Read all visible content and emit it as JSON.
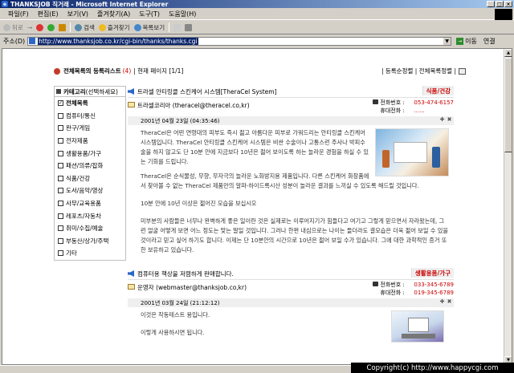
{
  "window": {
    "title": "THANKSJOB 직거래 - Microsoft Internet Explorer"
  },
  "menu": [
    "파일(F)",
    "편집(E)",
    "보기(V)",
    "즐겨찾기(A)",
    "도구(T)",
    "도움말(H)"
  ],
  "toolbar": {
    "back": "뒤로",
    "search": "검색",
    "favorites": "즐겨찾기",
    "history": "목록보기"
  },
  "address": {
    "label": "주소(D)",
    "url": "http://www.thanksjob.co.kr/cgi-bin/thanks/thanks.cgi",
    "go": "이동",
    "links": "연결"
  },
  "page": {
    "list_title": "전체목록의 등록리스트",
    "count": "(4)",
    "current_page": "| 현재 페이지 [1/1]",
    "top_links": "| 등록순정렬 | 전체목록정렬 |"
  },
  "sidebar": {
    "header_bold": "카테고리",
    "header_sub": "(선택하세요)",
    "items": [
      {
        "label": "전체목록",
        "checked": true
      },
      {
        "label": "컴퓨터/통신",
        "checked": false
      },
      {
        "label": "완구/게임",
        "checked": false
      },
      {
        "label": "전자제품",
        "checked": false
      },
      {
        "label": "생활용품/가구",
        "checked": false
      },
      {
        "label": "패션/의류/잡화",
        "checked": false
      },
      {
        "label": "식품/건강",
        "checked": false
      },
      {
        "label": "도서/음악/영상",
        "checked": false
      },
      {
        "label": "사무/교육용품",
        "checked": false
      },
      {
        "label": "레포츠/자동차",
        "checked": false
      },
      {
        "label": "취미/수집/예술",
        "checked": false
      },
      {
        "label": "부동산/상가/주택",
        "checked": false
      },
      {
        "label": "기타",
        "checked": false
      }
    ]
  },
  "entries": [
    {
      "title": "트라셀 안티링클 스킨케어 시스템[TheraCel System]",
      "category": "식품/건강",
      "seller": "트라셀코리아 (theracel@theracel.co,kr)",
      "phone_label": "전화번호 :",
      "phone": "053-474-6157",
      "mobile_label": "휴대전화 :",
      "mobile": "......",
      "date": "2001년 04월 23일 (04:35:46)",
      "body": [
        "TheraCel은 어떤 연령대의 피부도 즉시 젊고 아름다운 피부로 가꿔드리는 안티링클 스킨케어 시스템입니다. TheraCel 안티링클 스킨케어 시스템은 비싼 수술이나 고통스런 주사나 박피수술을 하지 않고도 단 10분 안에 지금보다 10년은 젊어 보이도록 하는 놀라운 경험을 하실 수 있는 기회를 드립니다.",
        "TheraCel은 순식물성, 무향, 무자극의 놀라운 노화방지용 제품입니다. 다른 스킨케어 화장품에서 찾아볼 수 없는 TheraCel 제품만의 알파-하이드록시산 성분이 놀라운 결과를 느끼실 수 있도록 해드릴 것입니다.",
        "10분 안에 10년 이상은 젊어진 모습을 보십시오",
        "미부분의 사람들은 너무나 완벽하게 좋은 일이란 것은 실제로는 이루어지기가 힘들다고 여기고 그렇게 믿으면서 자라왔는데, 그런 얼굴 어떻게 보면 어느 정도는 맞는 말일 것입니다. 그러나 한편 내심으로는 나이는 들더라도 결모습은 더욱 젊어 보일 수 있을 것이라고 믿고 싶어 하기도 합니다. 이제는 단 10분안의 시간으로 10년은 젊어 보일 수가 있습니다. 그에 대한 과학적인 증거 또한 보유하고 있습니다."
      ]
    },
    {
      "title": "컴퓨터용 책상을 저렴하게 판매합니다.",
      "category": "생활용품/가구",
      "seller": "운영자 (webmaster@thanksjob.co,kr)",
      "phone_label": "전화번호 :",
      "phone": "033-345-6789",
      "mobile_label": "휴대전화 :",
      "mobile": "019-345-6789",
      "date": "2001년 03월 24일 (21:12:12)",
      "body": [
        "이것은 작동테스트 용입니다.",
        "이렇게 사용하시면 됩니다."
      ]
    }
  ],
  "watermark": "Copyright(c) http://www.happycgi.com"
}
